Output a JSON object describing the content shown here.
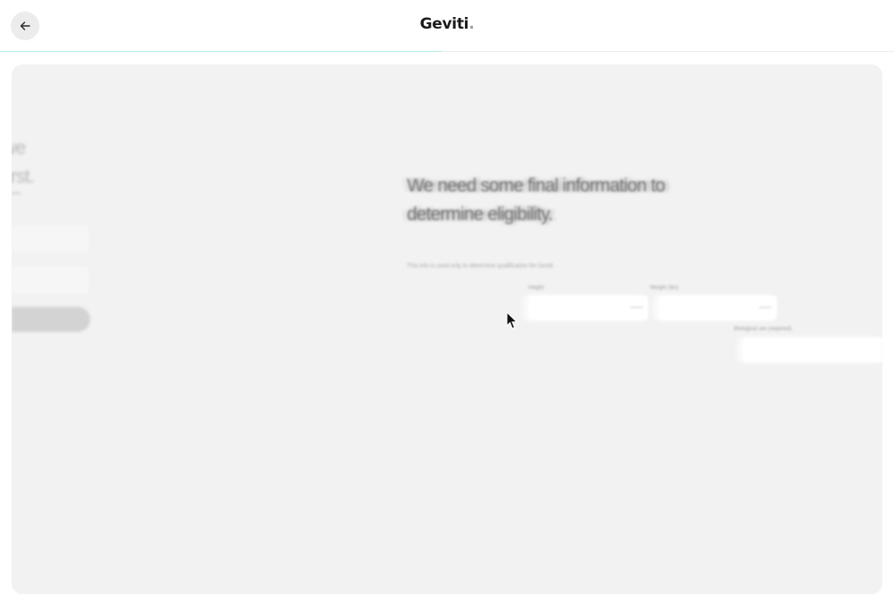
{
  "header": {
    "back_icon": "arrow-left-icon",
    "logo_text": "Geviti",
    "logo_dot": ".",
    "progress_percent": 49.5,
    "progress_color": "#b9ece6"
  },
  "previous_step": {
    "heading_lines": [
      "we",
      "first."
    ]
  },
  "step": {
    "heading": "We need some final information to determine eligibility.",
    "subtitle": "This info is used only to determine qualification for Geviti.",
    "fields": [
      {
        "label": "Height",
        "value": "",
        "suffix": ""
      },
      {
        "label": "Weight (lbs)",
        "value": "",
        "suffix": ""
      },
      {
        "label": "Biological sex (required)",
        "value": "",
        "suffix": ""
      }
    ]
  },
  "colors": {
    "card_background": "#f2f2f2",
    "input_background": "#ffffff",
    "back_button_background": "#ececec"
  }
}
